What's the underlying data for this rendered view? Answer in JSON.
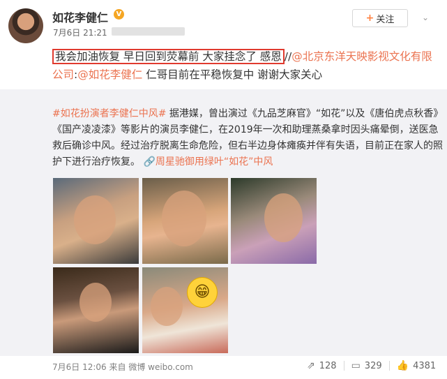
{
  "header": {
    "username": "如花李健仁",
    "verified_badge": "V",
    "timestamp": "7月6日 21:21",
    "follow_button": "关注",
    "follow_plus": "+"
  },
  "post": {
    "highlighted_text": "我会加油恢复 早日回到荧幕前 大家挂念了 感恩",
    "separator": "//",
    "mention1": "@北京东洋天映影视文化有限公司",
    "colon": ":",
    "mention2": "@如花李健仁",
    "rest": " 仁哥目前在平稳恢复中 谢谢大家关心"
  },
  "repost": {
    "hashtag": "#如花扮演者李健仁中风#",
    "body": " 据港媒，曾出演过《九品芝麻官》“如花”以及《唐伯虎点秋香》《国产凌凌漆》等影片的演员李健仁，在2019年一次和助理蒸桑拿时因头痛晕倒，送医急救后确诊中风。经过治疗脱离生命危险，但右半边身体瘫痪并伴有失语，目前正在家人的照护下进行治疗恢复。",
    "link_icon": "🔗",
    "link_text": "周星驰御用绿叶“如花”中风",
    "footer_date": "7月6日 12:06",
    "footer_source": "来自 微博 weibo.com",
    "repost_count": "128",
    "comment_count": "329",
    "like_count": "4381"
  }
}
